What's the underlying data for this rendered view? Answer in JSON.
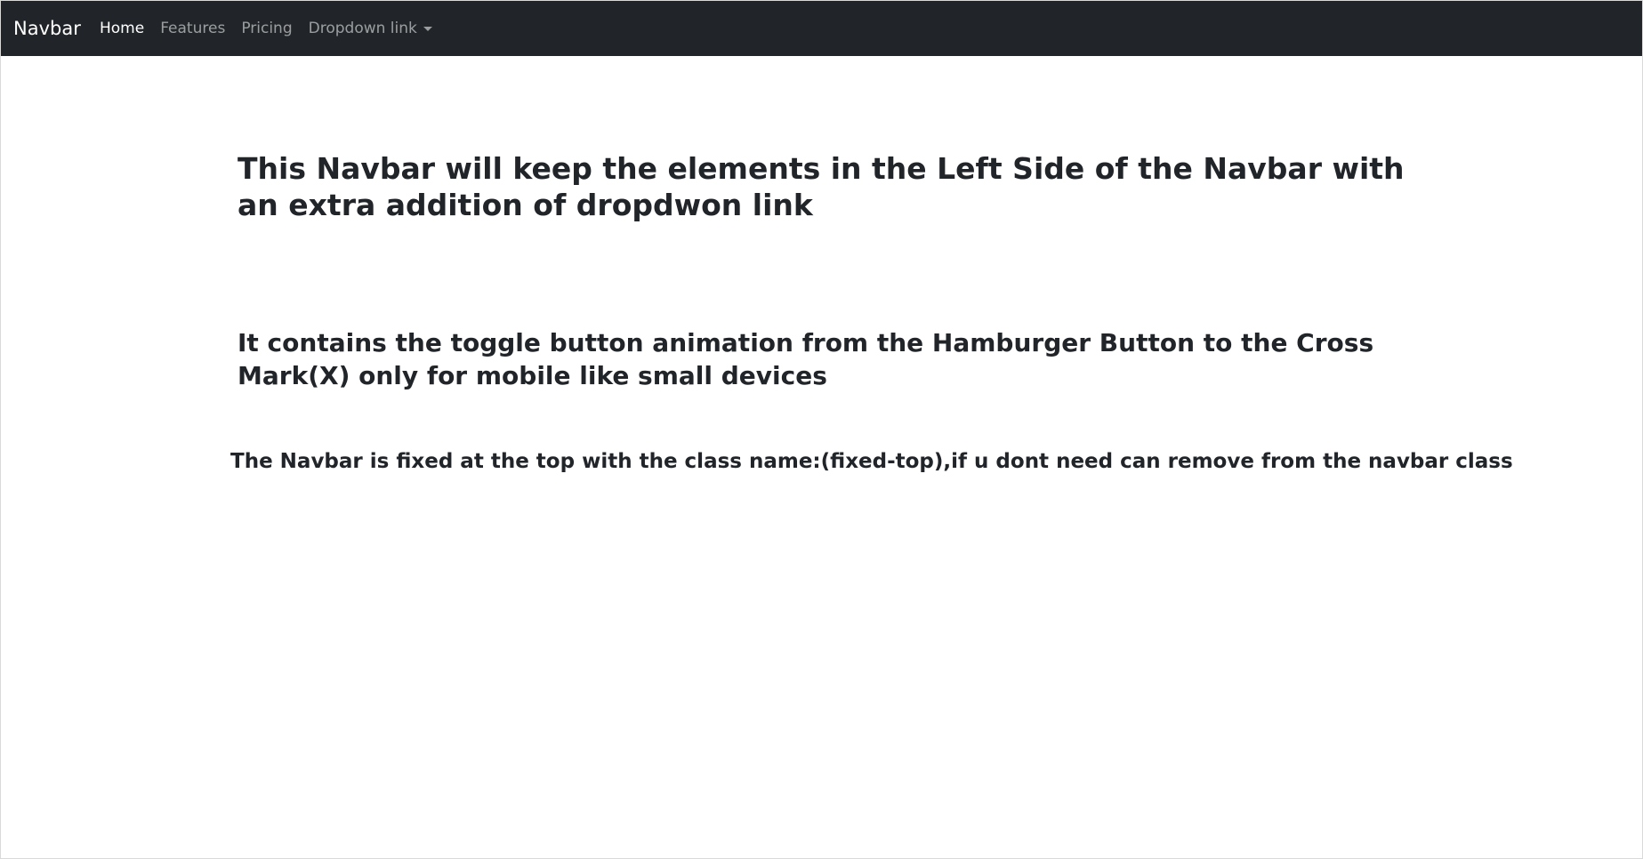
{
  "navbar": {
    "brand": "Navbar",
    "links": [
      {
        "label": "Home",
        "active": true
      },
      {
        "label": "Features",
        "active": false
      },
      {
        "label": "Pricing",
        "active": false
      },
      {
        "label": "Dropdown link",
        "active": false,
        "dropdown": true,
        "icon": "caret-down-icon"
      }
    ],
    "colors": {
      "background": "#212529",
      "active_text": "#ffffff",
      "inactive_text": "rgba(255,255,255,0.55)"
    }
  },
  "content": {
    "heading1": "This Navbar will keep the elements in the Left Side of the Navbar with an extra addition of dropdwon link",
    "heading2": "It contains the toggle button animation from the Hamburger Button to the Cross Mark(X) only for mobile like small devices",
    "heading3": "The Navbar is fixed at the top with the class name:(fixed-top),if u dont need can remove from the navbar class"
  }
}
